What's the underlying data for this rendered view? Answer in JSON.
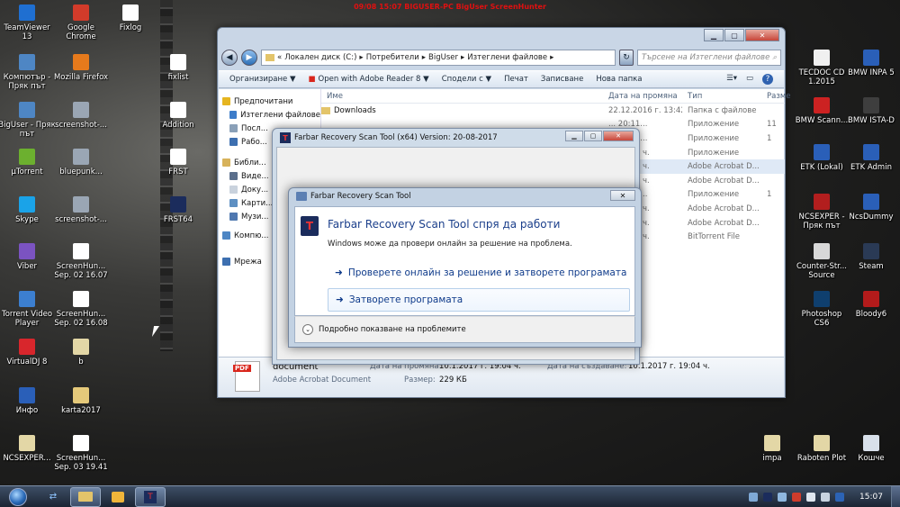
{
  "topbar": {
    "text": "09/08  15:07  BIGUSER-PC  BigUser  ScreenHunter"
  },
  "desktop_icons": [
    {
      "label": "TeamViewer 13",
      "icon": "teamviewer-icon",
      "color": "#1f6fd1"
    },
    {
      "label": "Google Chrome",
      "icon": "chrome-icon",
      "color": "#d23b2a"
    },
    {
      "label": "Fixlog",
      "icon": "text-file-icon",
      "color": "#ffffff"
    },
    {
      "label": "Компютър - Пряк път",
      "icon": "computer-icon",
      "color": "#4e86c4"
    },
    {
      "label": "Mozilla Firefox",
      "icon": "firefox-icon",
      "color": "#e67a1c"
    },
    {
      "label": "fixlist",
      "icon": "text-file-icon",
      "color": "#ffffff"
    },
    {
      "label": "BigUser - Пряк път",
      "icon": "user-folder-icon",
      "color": "#4e86c4"
    },
    {
      "label": "screenshot-...",
      "icon": "image-file-icon",
      "color": "#9aa6b4"
    },
    {
      "label": "Addition",
      "icon": "text-file-icon",
      "color": "#ffffff"
    },
    {
      "label": "µTorrent",
      "icon": "utorrent-icon",
      "color": "#6cb02f"
    },
    {
      "label": "bluepunk...",
      "icon": "image-file-icon",
      "color": "#9aa6b4"
    },
    {
      "label": "FRST",
      "icon": "text-file-icon",
      "color": "#ffffff"
    },
    {
      "label": "FRST64",
      "icon": "frst-icon",
      "color": "#1b2c5c"
    },
    {
      "label": "Skype",
      "icon": "skype-icon",
      "color": "#1aa3e8"
    },
    {
      "label": "screenshot-...",
      "icon": "image-file-icon",
      "color": "#9aa6b4"
    },
    {
      "label": "Viber",
      "icon": "viber-icon",
      "color": "#7b53c1"
    },
    {
      "label": "ScreenHun... Sep. 02 16.07",
      "icon": "image-file-icon",
      "color": "#ffffff"
    },
    {
      "label": "Torrent Video Player",
      "icon": "torrent-player-icon",
      "color": "#3c7fd0"
    },
    {
      "label": "ScreenHun... Sep. 02 16.08",
      "icon": "image-file-icon",
      "color": "#ffffff"
    },
    {
      "label": "VirtualDJ 8",
      "icon": "virtualdj-icon",
      "color": "#d8262c"
    },
    {
      "label": "b",
      "icon": "archive-icon",
      "color": "#e3d7a6"
    },
    {
      "label": "Инфо",
      "icon": "word-doc-icon",
      "color": "#2a5fb8"
    },
    {
      "label": "karta2017",
      "icon": "folder-icon",
      "color": "#e5c97a"
    },
    {
      "label": "NCSEXPER...",
      "icon": "archive-icon",
      "color": "#e3d7a6"
    },
    {
      "label": "ScreenHun... Sep. 03 19.41",
      "icon": "image-file-icon",
      "color": "#ffffff"
    },
    {
      "label": "TECDOC CD 1.2015",
      "icon": "tecdoc-icon",
      "color": "#f0f0f0"
    },
    {
      "label": "BMW INPA 5",
      "icon": "bmw-icon",
      "color": "#2a5fb8"
    },
    {
      "label": "BMW Scann...",
      "icon": "bmw-scanner-icon",
      "color": "#cc2222"
    },
    {
      "label": "BMW ISTA-D",
      "icon": "bmw-ista-icon",
      "color": "#3e3e3e"
    },
    {
      "label": "ETK (Lokal)",
      "icon": "etk-icon",
      "color": "#2a5fb8"
    },
    {
      "label": "ETK Admin",
      "icon": "etk-admin-icon",
      "color": "#2a5fb8"
    },
    {
      "label": "NCSEXPER - Пряк път",
      "icon": "ncsexper-icon",
      "color": "#b21e1e"
    },
    {
      "label": "NcsDummy",
      "icon": "ncsdummy-icon",
      "color": "#2a5fb8"
    },
    {
      "label": "Counter-Str... Source",
      "icon": "counter-strike-icon",
      "color": "#d8d8d8"
    },
    {
      "label": "Steam",
      "icon": "steam-icon",
      "color": "#2a3a55"
    },
    {
      "label": "Photoshop CS6",
      "icon": "photoshop-icon",
      "color": "#0f3f6e"
    },
    {
      "label": "Bloody6",
      "icon": "bloody-icon",
      "color": "#b31b1b"
    },
    {
      "label": "impa",
      "icon": "archive-icon",
      "color": "#e3d7a6"
    },
    {
      "label": "Raboten Plot",
      "icon": "archive-icon",
      "color": "#e3d7a6"
    },
    {
      "label": "Кошче",
      "icon": "recycle-bin-icon",
      "color": "#d8e0ea"
    }
  ],
  "explorer": {
    "breadcrumb": [
      "«",
      "Локален диск (C:)",
      "▸",
      "Потребители",
      "▸",
      "BigUser",
      "▸",
      "Изтеглени файлове",
      "▸"
    ],
    "search_placeholder": "Търсене на Изтеглени файлове",
    "toolbar": [
      "Организиране ▼",
      "Open with Adobe Reader 8 ▼",
      "Сподели с ▼",
      "Печат",
      "Записване",
      "Нова папка"
    ],
    "nav": [
      "Предпочитани",
      "Изтеглени файлове",
      "Посл...",
      "Рабо...",
      "Библи...",
      "Виде...",
      "Доку...",
      "Карти...",
      "Музи...",
      "Компю...",
      "Мрежа"
    ],
    "columns": [
      "Име",
      "Дата на промяна",
      "Тип",
      "Разме"
    ],
    "rows": [
      {
        "name": "Downloads",
        "date": "22.12.2016 г. 13:42...",
        "type": "Папка с файлове",
        "size": ""
      },
      {
        "name": "",
        "date": "... 20:11...",
        "type": "Приложение",
        "size": "11"
      },
      {
        "name": "",
        "date": "... 13:53...",
        "type": "Приложение",
        "size": "1"
      },
      {
        "name": "",
        "date": "... 17:22 ч.",
        "type": "Приложение",
        "size": ""
      },
      {
        "name": "",
        "date": "... 19:04 ч.",
        "type": "Adobe Acrobat D...",
        "size": ""
      },
      {
        "name": "",
        "date": "... 18:45 ч.",
        "type": "Adobe Acrobat D...",
        "size": ""
      },
      {
        "name": "",
        "date": "... 14:45...",
        "type": "Приложение",
        "size": "1"
      },
      {
        "name": "",
        "date": "... 17:36 ч.",
        "type": "Adobe Acrobat D...",
        "size": ""
      },
      {
        "name": "",
        "date": "... 17:36 ч.",
        "type": "Adobe Acrobat D...",
        "size": ""
      },
      {
        "name": "",
        "date": "... 21:42 ч.",
        "type": "BitTorrent File",
        "size": ""
      }
    ],
    "details": {
      "name": "document",
      "type": "Adobe Acrobat Document",
      "modified_label": "Дата на промяна:",
      "modified": "10.1.2017 г. 19:04 ч.",
      "created_label": "Дата на създаване:",
      "created": "10.1.2017 г. 19:04 ч.",
      "size_label": "Размер:",
      "size": "229 КБ"
    }
  },
  "farbar_window": {
    "title": "Farbar Recovery Scan Tool (x64) Version: 20-08-2017"
  },
  "dialog": {
    "title": "Farbar Recovery Scan Tool",
    "heading": "Farbar Recovery Scan Tool спря да работи",
    "subtext": "Windows може да провери онлайн за решение на проблема.",
    "option1": "Проверете онлайн за решение и затворете програмата",
    "option2": "Затворете програмата",
    "details_toggle": "Подробно показване на проблемите"
  },
  "taskbar": {
    "clock": "15:07"
  }
}
